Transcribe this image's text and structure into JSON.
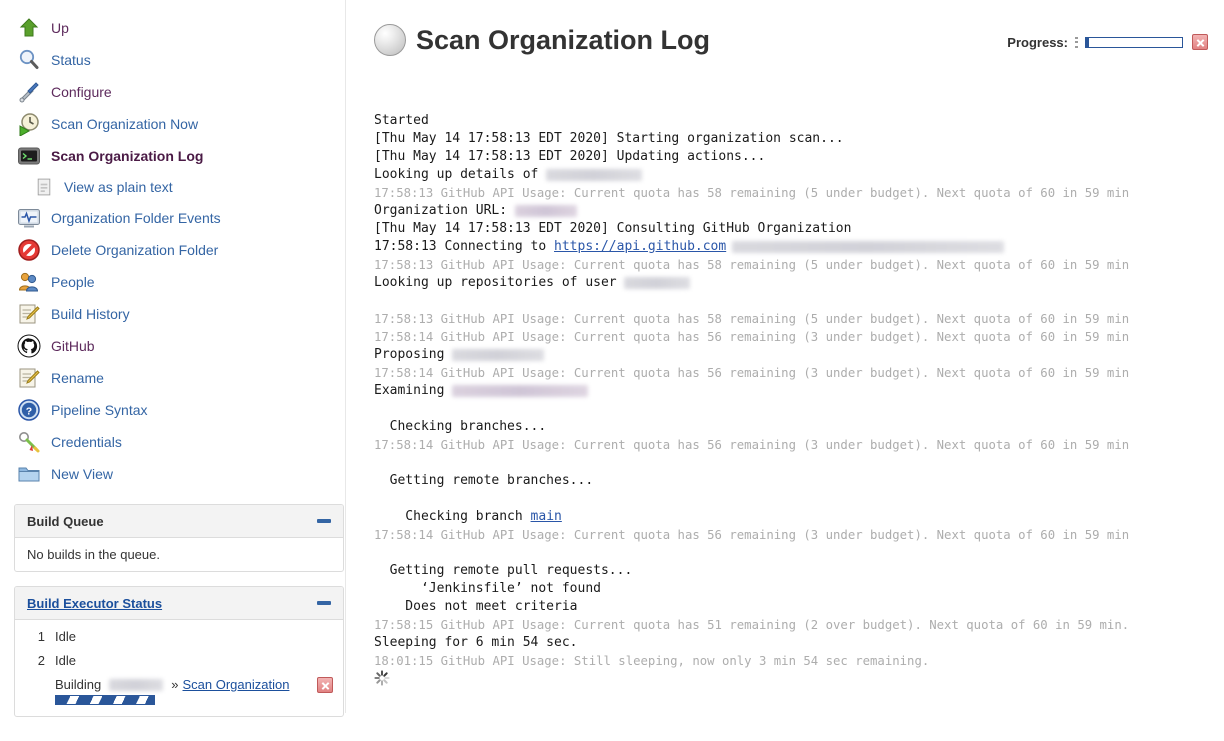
{
  "sidebar": {
    "tasks": [
      {
        "label": "Up",
        "icon": "up-arrow-icon",
        "state": "visited"
      },
      {
        "label": "Status",
        "icon": "magnifier-icon",
        "state": "normal"
      },
      {
        "label": "Configure",
        "icon": "wrench-screwdriver-icon",
        "state": "visited"
      },
      {
        "label": "Scan Organization Now",
        "icon": "clock-play-icon",
        "state": "normal"
      },
      {
        "label": "Scan Organization Log",
        "icon": "terminal-icon",
        "state": "active"
      },
      {
        "label": "View as plain text",
        "icon": "document-icon",
        "state": "sub"
      },
      {
        "label": "Organization Folder Events",
        "icon": "monitor-pulse-icon",
        "state": "normal"
      },
      {
        "label": "Delete Organization Folder",
        "icon": "no-entry-icon",
        "state": "normal"
      },
      {
        "label": "People",
        "icon": "people-icon",
        "state": "normal"
      },
      {
        "label": "Build History",
        "icon": "notepad-pencil-icon",
        "state": "normal"
      },
      {
        "label": "GitHub",
        "icon": "github-icon",
        "state": "visited"
      },
      {
        "label": "Rename",
        "icon": "notepad-pencil-icon",
        "state": "normal"
      },
      {
        "label": "Pipeline Syntax",
        "icon": "help-question-icon",
        "state": "normal"
      },
      {
        "label": "Credentials",
        "icon": "keys-icon",
        "state": "normal"
      },
      {
        "label": "New View",
        "icon": "folder-icon",
        "state": "normal"
      }
    ],
    "build_queue": {
      "title": "Build Queue",
      "empty_text": "No builds in the queue."
    },
    "build_executor_status": {
      "title": "Build Executor Status",
      "executors": [
        {
          "num": "1",
          "state": "Idle"
        },
        {
          "num": "2",
          "state": "Idle"
        }
      ],
      "building": {
        "prefix": "Building",
        "redacted_job": "",
        "separator": "»",
        "link_label": "Scan Organization"
      }
    }
  },
  "main": {
    "title": "Scan Organization Log",
    "progress": {
      "label": "Progress:",
      "percent": 3
    },
    "console_lines": [
      {
        "type": "text",
        "text": "Started"
      },
      {
        "type": "text",
        "text": "[Thu May 14 17:58:13 EDT 2020] Starting organization scan..."
      },
      {
        "type": "text",
        "text": "[Thu May 14 17:58:13 EDT 2020] Updating actions..."
      },
      {
        "type": "redacted",
        "text": "Looking up details of ",
        "redact_width": 96,
        "redact_tone": "gray"
      },
      {
        "type": "api",
        "text": "17:58:13 GitHub API Usage: Current quota has 58 remaining (5 under budget). Next quota of 60 in 59 min"
      },
      {
        "type": "redacted",
        "text": "Organization URL: ",
        "redact_width": 62,
        "redact_tone": "pink"
      },
      {
        "type": "text",
        "text": "[Thu May 14 17:58:13 EDT 2020] Consulting GitHub Organization"
      },
      {
        "type": "link",
        "text": "17:58:13 Connecting to ",
        "link": "https://api.github.com",
        "after_redact_width": 272,
        "redact_tone": "gray"
      },
      {
        "type": "api",
        "text": "17:58:13 GitHub API Usage: Current quota has 58 remaining (5 under budget). Next quota of 60 in 59 min"
      },
      {
        "type": "redacted",
        "text": "Looking up repositories of user ",
        "redact_width": 66,
        "redact_tone": "gray"
      },
      {
        "type": "blank",
        "text": ""
      },
      {
        "type": "api",
        "text": "17:58:13 GitHub API Usage: Current quota has 58 remaining (5 under budget). Next quota of 60 in 59 min"
      },
      {
        "type": "api",
        "text": "17:58:14 GitHub API Usage: Current quota has 56 remaining (3 under budget). Next quota of 60 in 59 min"
      },
      {
        "type": "redacted",
        "text": "Proposing ",
        "redact_width": 92,
        "redact_tone": "gray"
      },
      {
        "type": "api",
        "text": "17:58:14 GitHub API Usage: Current quota has 56 remaining (3 under budget). Next quota of 60 in 59 min"
      },
      {
        "type": "redacted",
        "text": "Examining ",
        "redact_width": 136,
        "redact_tone": "pink"
      },
      {
        "type": "blank",
        "text": ""
      },
      {
        "type": "text",
        "text": "  Checking branches..."
      },
      {
        "type": "api",
        "text": "17:58:14 GitHub API Usage: Current quota has 56 remaining (3 under budget). Next quota of 60 in 59 min"
      },
      {
        "type": "blank",
        "text": ""
      },
      {
        "type": "text",
        "text": "  Getting remote branches..."
      },
      {
        "type": "blank",
        "text": ""
      },
      {
        "type": "link",
        "text": "    Checking branch ",
        "link": "main",
        "after_redact_width": 0,
        "redact_tone": "gray"
      },
      {
        "type": "api",
        "text": "17:58:14 GitHub API Usage: Current quota has 56 remaining (3 under budget). Next quota of 60 in 59 min"
      },
      {
        "type": "blank",
        "text": ""
      },
      {
        "type": "text",
        "text": "  Getting remote pull requests..."
      },
      {
        "type": "text",
        "text": "      ‘Jenkinsfile’ not found"
      },
      {
        "type": "text",
        "text": "    Does not meet criteria"
      },
      {
        "type": "api",
        "text": "17:58:15 GitHub API Usage: Current quota has 51 remaining (2 over budget). Next quota of 60 in 59 min."
      },
      {
        "type": "text",
        "text": "Sleeping for 6 min 54 sec."
      },
      {
        "type": "api",
        "text": "18:01:15 GitHub API Usage: Still sleeping, now only 3 min 54 sec remaining."
      },
      {
        "type": "spinner",
        "text": ""
      }
    ]
  },
  "colors": {
    "link": "#3465a4",
    "active_link": "#4a1a45",
    "accent_blue": "#2a5699",
    "api_gray": "#adadad",
    "panel_header": "#f3f3f3",
    "border": "#dcdcdc"
  }
}
